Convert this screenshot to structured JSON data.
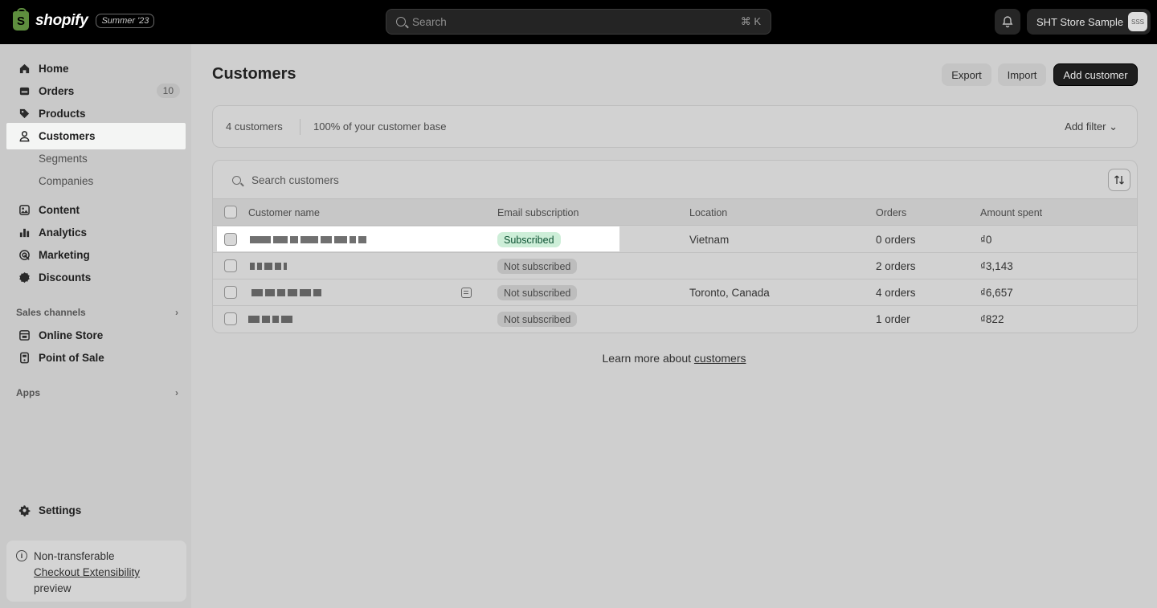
{
  "topbar": {
    "logo_text": "shopify",
    "edition_badge": "Summer '23",
    "search_placeholder": "Search",
    "search_shortcut": "⌘ K",
    "store_name": "SHT Store Sample",
    "store_initials": "SSS"
  },
  "sidebar": {
    "items": [
      {
        "label": "Home",
        "icon": "home-icon"
      },
      {
        "label": "Orders",
        "icon": "orders-icon",
        "badge": "10"
      },
      {
        "label": "Products",
        "icon": "tag-icon"
      },
      {
        "label": "Customers",
        "icon": "person-icon",
        "active": true
      },
      {
        "label": "Segments"
      },
      {
        "label": "Companies"
      },
      {
        "label": "Content",
        "icon": "content-icon"
      },
      {
        "label": "Analytics",
        "icon": "bar-chart-icon"
      },
      {
        "label": "Marketing",
        "icon": "target-icon"
      },
      {
        "label": "Discounts",
        "icon": "discount-icon"
      }
    ],
    "sales_channels_label": "Sales channels",
    "channels": [
      {
        "label": "Online Store",
        "icon": "store-icon"
      },
      {
        "label": "Point of Sale",
        "icon": "pos-icon"
      }
    ],
    "apps_label": "Apps",
    "settings_label": "Settings",
    "notice": {
      "line1": "Non-transferable",
      "link": "Checkout Extensibility",
      "line3": "preview"
    }
  },
  "main": {
    "title": "Customers",
    "export_label": "Export",
    "import_label": "Import",
    "add_label": "Add customer",
    "filter": {
      "count": "4 customers",
      "percent": "100% of your customer base",
      "add_filter": "Add filter"
    },
    "table": {
      "search_placeholder": "Search customers",
      "headers": [
        "Customer name",
        "Email subscription",
        "Location",
        "Orders",
        "Amount spent"
      ],
      "rows": [
        {
          "subscription": "Subscribed",
          "location": "Vietnam",
          "orders": "0 orders",
          "amount": "₫0"
        },
        {
          "subscription": "Not subscribed",
          "location": "",
          "orders": "2 orders",
          "amount": "₫3,143"
        },
        {
          "subscription": "Not subscribed",
          "location": "Toronto, Canada",
          "orders": "4 orders",
          "amount": "₫6,657"
        },
        {
          "subscription": "Not subscribed",
          "location": "",
          "orders": "1 order",
          "amount": "₫822"
        }
      ]
    },
    "learn_prefix": "Learn more about ",
    "learn_link": "customers"
  }
}
